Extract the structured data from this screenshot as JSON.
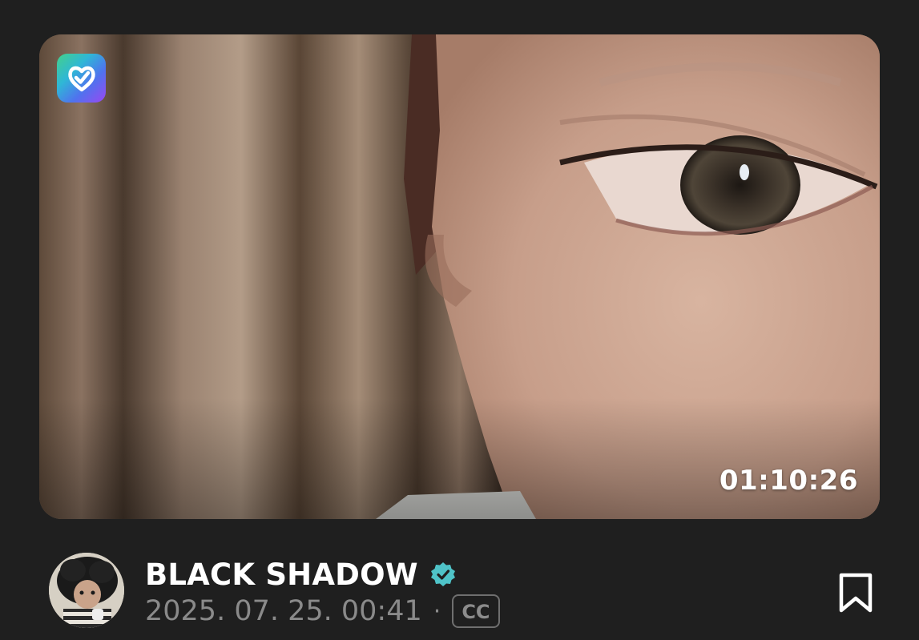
{
  "video": {
    "duration": "01:10:26",
    "app_logo_icon": "heart-check-logo-icon"
  },
  "channel": {
    "name": "BLACK SHADOW",
    "verified_icon": "verified-badge-icon",
    "verified_color": "#4fc3c8"
  },
  "meta": {
    "date": "2025. 07. 25. 00:41",
    "separator": "·",
    "cc_label": "CC"
  },
  "actions": {
    "bookmark_icon": "bookmark-icon"
  },
  "colors": {
    "background": "#1f1f1f",
    "primary_text": "#ffffff",
    "secondary_text": "#8a8a8a"
  }
}
